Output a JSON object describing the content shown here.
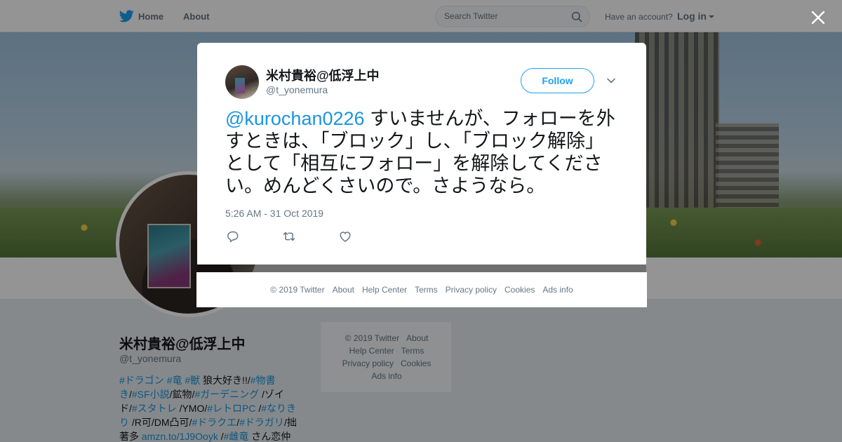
{
  "nav": {
    "home_label": "Home",
    "about_label": "About",
    "search_placeholder": "Search Twitter",
    "have_account": "Have an account?",
    "login_label": "Log in"
  },
  "profile": {
    "name": "米村貴裕@低浮上中",
    "handle": "@t_yonemura",
    "bio": {
      "line1_tag1": "#ドラゴン",
      "line1_tag2": "#竜",
      "line1_tag3": "#獣",
      "line1_text": " 狼大好き!!/",
      "line1_tag4": "#物書",
      "line2_tag4b": "き",
      "line2_text1": "/",
      "line2_tag5": "#SF小説",
      "line2_text2": "/鉱物/",
      "line2_tag6": "#ガーデニング",
      "line2_text3": " /ゾイ",
      "line3_text1": "ド/",
      "line3_tag7": "#スタトレ",
      "line3_text2": " /YMO/",
      "line3_tag8": "#レトロPC",
      "line3_text3": " /",
      "line3_tag9": "#なりき",
      "line4_tag9b": "り",
      "line4_text1": " /R可/DM凸可/",
      "line4_tag10": "#ドラクエ",
      "line4_text2": "/",
      "line4_tag11": "#ドラガリ",
      "line4_text3": "/拙",
      "line5_text1": "著多 ",
      "line5_link": "amzn.to/1J9Ooyk",
      "line5_text2": " /",
      "line5_tag12": "#雌竜",
      "line5_text3": " さん恋仲"
    }
  },
  "side_footer": {
    "copyright": "© 2019 Twitter",
    "about": "About",
    "help": "Help Center",
    "terms": "Terms",
    "privacy": "Privacy policy",
    "cookies": "Cookies",
    "ads": "Ads info"
  },
  "tweet": {
    "author_name": "米村貴裕@低浮上中",
    "author_handle": "@t_yonemura",
    "follow_label": "Follow",
    "mention": "@kurochan0226",
    "text": " すいませんが、フォローを外すときは、「ブロック」し、「ブロック解除」として「相互にフォロー」を解除してください。めんどくさいので。さようなら。",
    "timestamp": "5:26 AM - 31 Oct 2019"
  },
  "modal_footer": {
    "copyright": "© 2019 Twitter",
    "about": "About",
    "help": "Help Center",
    "terms": "Terms",
    "privacy": "Privacy policy",
    "cookies": "Cookies",
    "ads": "Ads info"
  },
  "colors": {
    "accent": "#1da1f2",
    "link": "#1b95e0",
    "muted": "#657786"
  }
}
